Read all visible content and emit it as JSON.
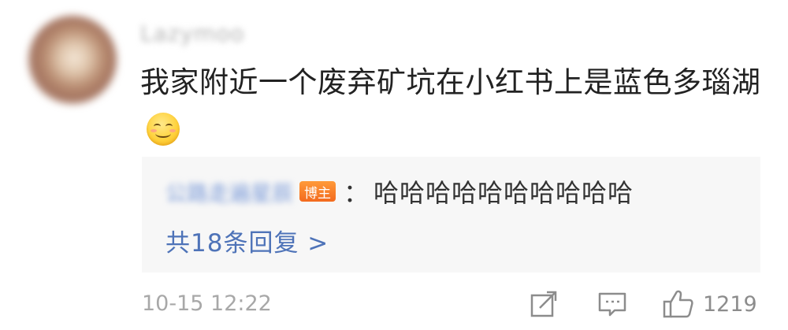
{
  "comment": {
    "username": "Lazymoo",
    "text": "我家附近一个废弃矿坑在小红书上是蓝色多瑙湖",
    "emoji_icon": "smile-emoji",
    "timestamp": "10-15 12:22",
    "like_count": "1219"
  },
  "reply": {
    "username": "公路走遍星辰",
    "badge": "博主",
    "colon": "：",
    "text": "哈哈哈哈哈哈哈哈哈哈",
    "more_label": "共18条回复 >"
  },
  "colors": {
    "link": "#4e73b8",
    "badge": "#f36a1e",
    "text": "#222222",
    "muted": "#a8a8a8"
  }
}
